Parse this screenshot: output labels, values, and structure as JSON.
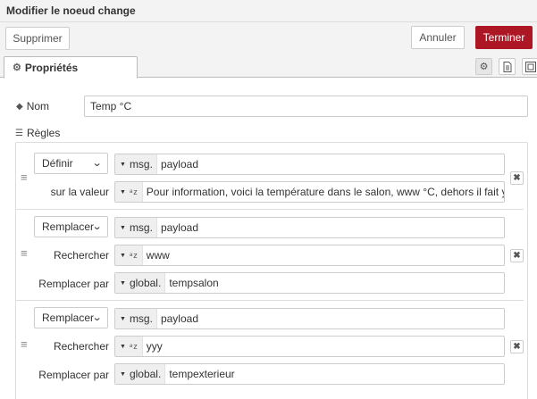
{
  "dialog": {
    "title": "Modifier le noeud change"
  },
  "toolbar": {
    "delete_label": "Supprimer",
    "cancel_label": "Annuler",
    "done_label": "Terminer"
  },
  "tabs": {
    "properties_label": "Propriétés"
  },
  "tab_icons": [
    "gear-icon",
    "document-icon",
    "frame-icon"
  ],
  "form": {
    "name_label": "Nom",
    "name_value": "Temp °C",
    "rules_label": "Règles"
  },
  "rules": [
    {
      "action": "Définir",
      "target_type": "msg.",
      "target_value": "payload",
      "to_label": "sur la valeur",
      "to_type": "az",
      "to_value": "Pour information, voici la température dans le salon,  www °C, dehors il fait yyy °C"
    },
    {
      "action": "Remplacer",
      "target_type": "msg.",
      "target_value": "payload",
      "search_label": "Rechercher",
      "search_type": "az",
      "search_value": "www",
      "replace_label": "Remplacer par",
      "replace_type": "global.",
      "replace_value": "tempsalon"
    },
    {
      "action": "Remplacer",
      "target_type": "msg.",
      "target_value": "payload",
      "search_label": "Rechercher",
      "search_type": "az",
      "search_value": "yyy",
      "replace_label": "Remplacer par",
      "replace_type": "global.",
      "replace_value": "tempexterieur"
    }
  ],
  "colors": {
    "primary": "#ad1625",
    "header_bg": "#f3f3f3",
    "border": "#cccccc"
  }
}
